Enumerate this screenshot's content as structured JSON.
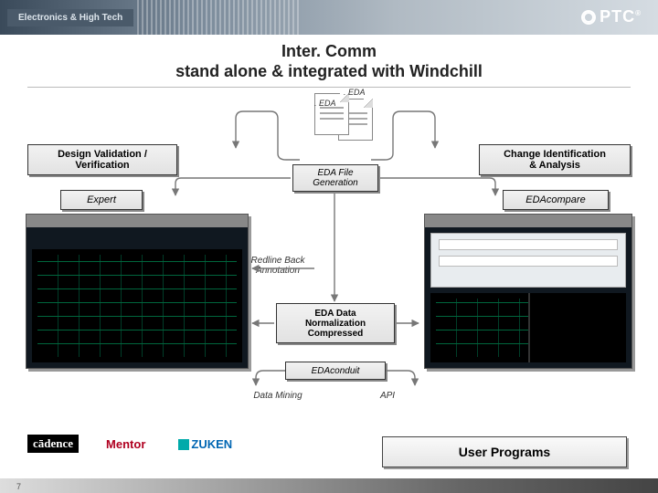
{
  "header": {
    "tab": "Electronics & High Tech",
    "logo": "PTC"
  },
  "title": {
    "line1": "Inter. Comm",
    "line2": "stand alone & integrated with Windchill"
  },
  "icons": {
    "eda_a": ". EDA",
    "eda_b": ". EDA"
  },
  "nodes": {
    "left_header": {
      "l1": "Design Validation /",
      "l2": "Verification"
    },
    "right_header": {
      "l1": "Change Identification",
      "l2": "& Analysis"
    },
    "file_gen": {
      "l1": "EDA File",
      "l2": "Generation"
    },
    "expert": "Expert",
    "compare": "EDAcompare",
    "norm": {
      "l1": "EDA Data",
      "l2": "Normalization",
      "l3": "Compressed"
    },
    "conduit": "EDAconduit"
  },
  "labels": {
    "redline": {
      "l1": "Redline Back",
      "l2": "Annotation"
    },
    "mining": "Data Mining",
    "api": "API"
  },
  "partners": {
    "cadence": "cādence",
    "mentor": "Mentor",
    "zuken": "ZUKEN"
  },
  "user_programs": "User Programs",
  "page": "7"
}
